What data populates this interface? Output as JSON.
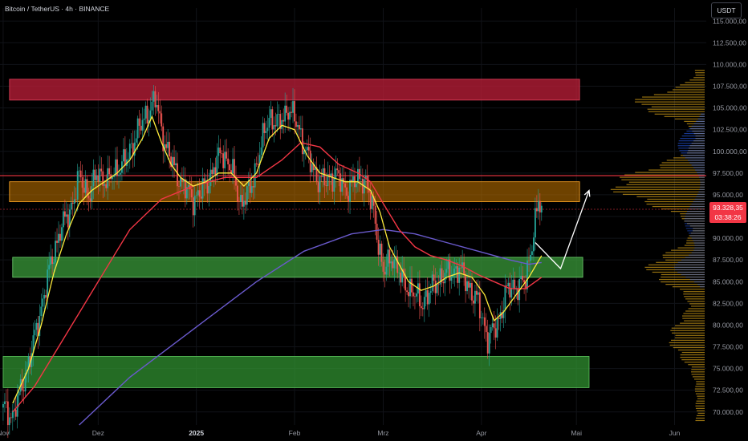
{
  "header": {
    "title": "Bitcoin / TetherUS · 4h · BINANCE",
    "currency": "USDT"
  },
  "price_tag": {
    "price": "93.328,35",
    "countdown": "03:38:26",
    "color": "#f23645"
  },
  "colors": {
    "bg": "#000000",
    "up": "#26a69a",
    "down": "#ef5350",
    "ma_fast": "#ffeb3b",
    "ma_mid": "#f23645",
    "ma_slow": "#6a5acd",
    "resistance": "#f23645",
    "volume_profile_orange": "#d4a017",
    "volume_profile_blue": "#2962ff"
  },
  "chart_data": {
    "type": "line",
    "y_ticks": [
      "115.000,00",
      "112.500,00",
      "110.000,00",
      "107.500,00",
      "105.000,00",
      "102.500,00",
      "100.000,00",
      "97.500,00",
      "95.000,00",
      "92.500,00",
      "90.000,00",
      "87.500,00",
      "85.000,00",
      "82.500,00",
      "80.000,00",
      "77.500,00",
      "75.000,00",
      "72.500,00",
      "70.000,00"
    ],
    "y_tick_values": [
      115000,
      112500,
      110000,
      107500,
      105000,
      102500,
      100000,
      97500,
      95000,
      92500,
      90000,
      87500,
      85000,
      82500,
      80000,
      77500,
      75000,
      72500,
      70000
    ],
    "ylim": [
      68500,
      116500
    ],
    "x_ticks": [
      {
        "label": "Nov",
        "day": 0,
        "bold": false
      },
      {
        "label": "Dez",
        "day": 30,
        "bold": false
      },
      {
        "label": "2025",
        "day": 61,
        "bold": true
      },
      {
        "label": "Feb",
        "day": 92,
        "bold": false
      },
      {
        "label": "Mrz",
        "day": 120,
        "bold": false
      },
      {
        "label": "Apr",
        "day": 151,
        "bold": false
      },
      {
        "label": "Mai",
        "day": 181,
        "bold": false
      },
      {
        "label": "Jun",
        "day": 212,
        "bold": false
      }
    ],
    "xlim": [
      -1,
      222
    ],
    "price_path": [
      [
        0,
        70500
      ],
      [
        3,
        69500
      ],
      [
        6,
        73000
      ],
      [
        9,
        77000
      ],
      [
        12,
        82000
      ],
      [
        15,
        87000
      ],
      [
        18,
        91000
      ],
      [
        21,
        93000
      ],
      [
        24,
        97000
      ],
      [
        27,
        95000
      ],
      [
        30,
        97500
      ],
      [
        33,
        96500
      ],
      [
        36,
        98000
      ],
      [
        39,
        99000
      ],
      [
        42,
        102000
      ],
      [
        45,
        104000
      ],
      [
        48,
        106000
      ],
      [
        51,
        101000
      ],
      [
        54,
        98000
      ],
      [
        57,
        96000
      ],
      [
        60,
        94500
      ],
      [
        63,
        95500
      ],
      [
        66,
        97500
      ],
      [
        69,
        100000
      ],
      [
        72,
        98000
      ],
      [
        75,
        94000
      ],
      [
        78,
        95500
      ],
      [
        81,
        100000
      ],
      [
        84,
        104000
      ],
      [
        87,
        103000
      ],
      [
        90,
        105000
      ],
      [
        93,
        103000
      ],
      [
        96,
        99500
      ],
      [
        99,
        97000
      ],
      [
        102,
        96500
      ],
      [
        105,
        97500
      ],
      [
        108,
        95500
      ],
      [
        111,
        96500
      ],
      [
        114,
        97000
      ],
      [
        117,
        93000
      ],
      [
        120,
        86000
      ],
      [
        123,
        88000
      ],
      [
        126,
        85000
      ],
      [
        129,
        84000
      ],
      [
        132,
        82500
      ],
      [
        135,
        84000
      ],
      [
        138,
        85500
      ],
      [
        141,
        86000
      ],
      [
        144,
        86500
      ],
      [
        147,
        84500
      ],
      [
        150,
        82500
      ],
      [
        153,
        78500
      ],
      [
        156,
        80000
      ],
      [
        159,
        84000
      ],
      [
        162,
        84500
      ],
      [
        165,
        85000
      ],
      [
        168,
        92000
      ],
      [
        169,
        94000
      ],
      [
        170,
        93300
      ]
    ],
    "ma_fast": [
      [
        3,
        71000
      ],
      [
        8,
        75000
      ],
      [
        12,
        80000
      ],
      [
        16,
        86000
      ],
      [
        20,
        90500
      ],
      [
        24,
        94000
      ],
      [
        28,
        95500
      ],
      [
        32,
        96500
      ],
      [
        36,
        97500
      ],
      [
        40,
        99000
      ],
      [
        44,
        101500
      ],
      [
        47,
        104000
      ],
      [
        50,
        101000
      ],
      [
        53,
        98500
      ],
      [
        56,
        97000
      ],
      [
        60,
        96000
      ],
      [
        64,
        96500
      ],
      [
        68,
        97500
      ],
      [
        72,
        97500
      ],
      [
        76,
        96000
      ],
      [
        80,
        97500
      ],
      [
        84,
        101500
      ],
      [
        88,
        103000
      ],
      [
        92,
        102500
      ],
      [
        96,
        99500
      ],
      [
        100,
        97500
      ],
      [
        104,
        97000
      ],
      [
        108,
        96500
      ],
      [
        112,
        96500
      ],
      [
        116,
        95500
      ],
      [
        119,
        93000
      ],
      [
        122,
        89000
      ],
      [
        125,
        87000
      ],
      [
        128,
        85000
      ],
      [
        132,
        84000
      ],
      [
        136,
        84500
      ],
      [
        140,
        85500
      ],
      [
        144,
        86000
      ],
      [
        148,
        85500
      ],
      [
        152,
        83500
      ],
      [
        155,
        80500
      ],
      [
        158,
        81500
      ],
      [
        162,
        83500
      ],
      [
        166,
        85500
      ],
      [
        170,
        88000
      ]
    ],
    "ma_mid": [
      [
        3,
        70000
      ],
      [
        10,
        73000
      ],
      [
        20,
        79000
      ],
      [
        30,
        85000
      ],
      [
        40,
        91000
      ],
      [
        50,
        94500
      ],
      [
        60,
        96000
      ],
      [
        70,
        97000
      ],
      [
        80,
        97000
      ],
      [
        88,
        99000
      ],
      [
        94,
        101000
      ],
      [
        100,
        100500
      ],
      [
        106,
        98500
      ],
      [
        112,
        97500
      ],
      [
        116,
        96500
      ],
      [
        120,
        94000
      ],
      [
        125,
        91000
      ],
      [
        130,
        89000
      ],
      [
        135,
        88000
      ],
      [
        140,
        87500
      ],
      [
        145,
        86800
      ],
      [
        150,
        85800
      ],
      [
        155,
        85000
      ],
      [
        160,
        84200
      ],
      [
        165,
        84200
      ],
      [
        170,
        85500
      ]
    ],
    "ma_slow": [
      [
        24,
        68500
      ],
      [
        40,
        74000
      ],
      [
        60,
        79500
      ],
      [
        80,
        85000
      ],
      [
        95,
        88500
      ],
      [
        110,
        90500
      ],
      [
        120,
        91000
      ],
      [
        130,
        90500
      ],
      [
        140,
        89500
      ],
      [
        150,
        88500
      ],
      [
        160,
        87500
      ],
      [
        166,
        87000
      ],
      [
        170,
        87200
      ]
    ],
    "projection": [
      [
        168,
        89500
      ],
      [
        176,
        86500
      ],
      [
        185,
        95500
      ]
    ],
    "resistance_level": 97200,
    "last_price_level": 93328
  },
  "annotations": {
    "red_zone": {
      "y1": 108300,
      "y2": 105900,
      "x1": 2,
      "x2": 182
    },
    "orange_zone": {
      "y1": 96500,
      "y2": 94200,
      "x1": 2,
      "x2": 182
    },
    "green_zone_upper": {
      "y1": 87800,
      "y2": 85500,
      "x1": 3,
      "x2": 183
    },
    "green_zone_lower": {
      "y1": 76400,
      "y2": 72800,
      "x1": 0,
      "x2": 185
    }
  }
}
